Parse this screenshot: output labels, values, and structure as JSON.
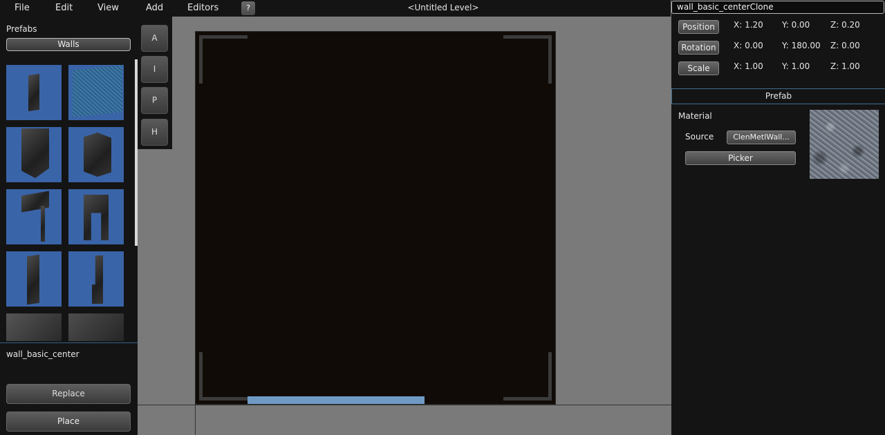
{
  "menu": {
    "items": [
      "File",
      "Edit",
      "View",
      "Add",
      "Editors"
    ],
    "help_label": "?",
    "level_title": "<Untitled Level>"
  },
  "left_panel": {
    "prefabs_label": "Prefabs",
    "category_button": "Walls",
    "selected_prefab": "wall_basic_center",
    "replace_label": "Replace",
    "place_label": "Place"
  },
  "tools": [
    "A",
    "I",
    "P",
    "H"
  ],
  "inspector": {
    "object_name": "wall_basic_centerClone",
    "transform": {
      "position": {
        "label": "Position",
        "x": "X: 1.20",
        "y": "Y: 0.00",
        "z": "Z: 0.20"
      },
      "rotation": {
        "label": "Rotation",
        "x": "X: 0.00",
        "y": "Y: 180.00",
        "z": "Z: 0.00"
      },
      "scale": {
        "label": "Scale",
        "x": "X: 1.00",
        "y": "Y: 1.00",
        "z": "Z: 1.00"
      }
    },
    "prefab_header": "Prefab",
    "material_label": "Material",
    "source_label": "Source",
    "source_value": "ClenMetlWall...",
    "picker_label": "Picker"
  },
  "colors": {
    "panel_bg": "#141414",
    "viewport_bg": "#7a7a7a",
    "thumb_bg": "#3a64a8",
    "accent_blue": "#6f9ac4"
  }
}
